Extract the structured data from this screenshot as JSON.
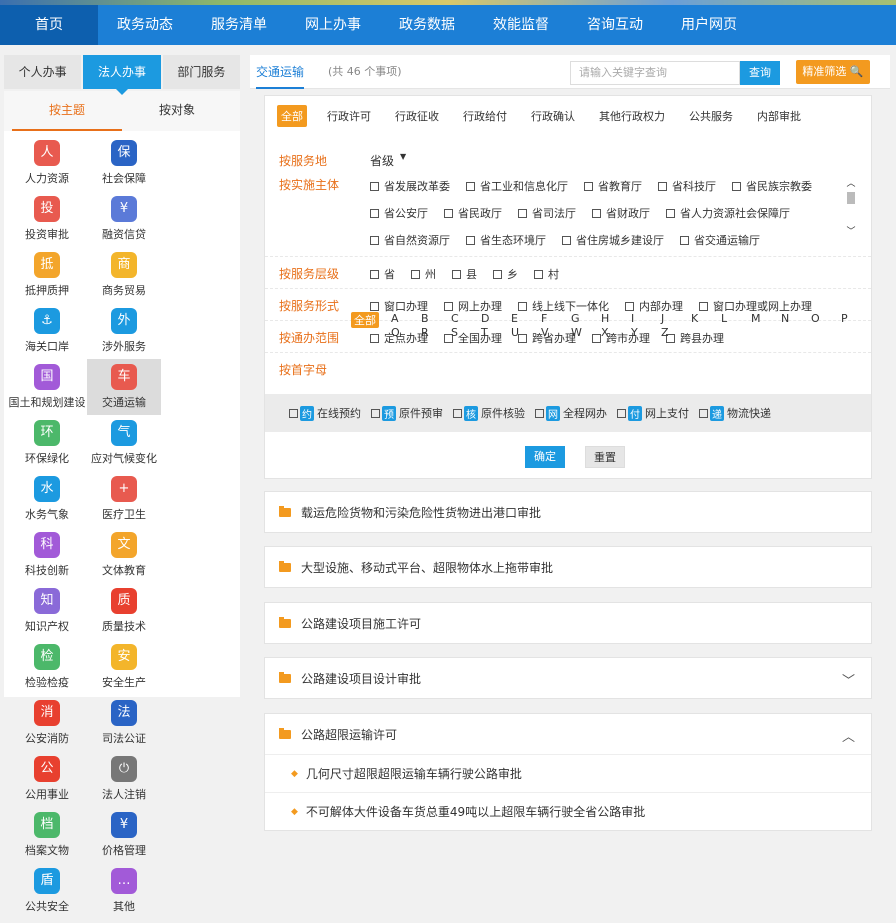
{
  "nav": [
    "首页",
    "政务动态",
    "服务清单",
    "网上办事",
    "政务数据",
    "效能监督",
    "咨询互动",
    "用户网页"
  ],
  "left": {
    "tabs": [
      "个人办事",
      "法人办事",
      "部门服务"
    ],
    "subtabs": [
      "按主题",
      "按对象"
    ],
    "categories": [
      {
        "label": "人力资源",
        "color": "#e85a4f",
        "glyph": "人"
      },
      {
        "label": "社会保障",
        "color": "#2a64c5",
        "glyph": "保"
      },
      {
        "label": "投资审批",
        "color": "#e85a4f",
        "glyph": "投"
      },
      {
        "label": "融资信贷",
        "color": "#5b7ad8",
        "glyph": "¥"
      },
      {
        "label": "抵押质押",
        "color": "#f3a52b",
        "glyph": "抵"
      },
      {
        "label": "商务贸易",
        "color": "#f3b52b",
        "glyph": "商"
      },
      {
        "label": "海关口岸",
        "color": "#1c9ae0",
        "glyph": "⚓"
      },
      {
        "label": "涉外服务",
        "color": "#1c9ae0",
        "glyph": "外"
      },
      {
        "label": "国土和规划建设",
        "color": "#a25ad8",
        "glyph": "国"
      },
      {
        "label": "交通运输",
        "color": "#e85a4f",
        "glyph": "车"
      },
      {
        "label": "环保绿化",
        "color": "#4cb86a",
        "glyph": "环"
      },
      {
        "label": "应对气候变化",
        "color": "#1c9ae0",
        "glyph": "气"
      },
      {
        "label": "水务气象",
        "color": "#1c9ae0",
        "glyph": "水"
      },
      {
        "label": "医疗卫生",
        "color": "#e85a4f",
        "glyph": "+"
      },
      {
        "label": "科技创新",
        "color": "#a25ad8",
        "glyph": "科"
      },
      {
        "label": "文体教育",
        "color": "#f3a52b",
        "glyph": "文"
      },
      {
        "label": "知识产权",
        "color": "#8a6ad8",
        "glyph": "知"
      },
      {
        "label": "质量技术",
        "color": "#e8402f",
        "glyph": "质"
      },
      {
        "label": "检验检疫",
        "color": "#4cb86a",
        "glyph": "检"
      },
      {
        "label": "安全生产",
        "color": "#f3b52b",
        "glyph": "安"
      },
      {
        "label": "公安消防",
        "color": "#e8402f",
        "glyph": "消"
      },
      {
        "label": "司法公证",
        "color": "#2a64c5",
        "glyph": "法"
      },
      {
        "label": "公用事业",
        "color": "#e8402f",
        "glyph": "公"
      },
      {
        "label": "法人注销",
        "color": "#777777",
        "glyph": "⏻"
      },
      {
        "label": "档案文物",
        "color": "#4cb86a",
        "glyph": "档"
      },
      {
        "label": "价格管理",
        "color": "#2a64c5",
        "glyph": "¥"
      },
      {
        "label": "公共安全",
        "color": "#1c9ae0",
        "glyph": "盾"
      },
      {
        "label": "其他",
        "color": "#a25ad8",
        "glyph": "…"
      }
    ]
  },
  "right": {
    "title": "交通运输",
    "count": "(共 46 个事项)",
    "search_placeholder": "请输入关键字查询",
    "search_btn": "查询",
    "advanced_btn": "精准筛选",
    "types": [
      "全部",
      "行政许可",
      "行政征收",
      "行政给付",
      "行政确认",
      "其他行政权力",
      "公共服务",
      "内部审批"
    ],
    "filters": {
      "place_label": "按服务地",
      "place_value": "省级",
      "body_label": "按实施主体",
      "bodies": [
        "省发展改革委",
        "省工业和信息化厅",
        "省教育厅",
        "省科技厅",
        "省民族宗教委",
        "省公安厅",
        "省民政厅",
        "省司法厅",
        "省财政厅",
        "省人力资源社会保障厅",
        "省自然资源厅",
        "省生态环境厅",
        "省住房城乡建设厅",
        "省交通运输厅"
      ],
      "level_label": "按服务层级",
      "levels": [
        "省",
        "州",
        "县",
        "乡",
        "村"
      ],
      "form_label": "按服务形式",
      "forms": [
        "窗口办理",
        "网上办理",
        "线上线下一体化",
        "内部办理",
        "窗口办理或网上办理"
      ],
      "range_label": "按通办范围",
      "ranges": [
        "定点办理",
        "全国办理",
        "跨省办理",
        "跨市办理",
        "跨县办理"
      ],
      "letter_label": "按首字母",
      "letters_all": "全部",
      "letters": [
        "A",
        "B",
        "C",
        "D",
        "E",
        "F",
        "G",
        "H",
        "I",
        "J",
        "K",
        "L",
        "M",
        "N",
        "O",
        "P",
        "Q",
        "R",
        "S",
        "T",
        "U",
        "V",
        "W",
        "X",
        "Y",
        "Z"
      ]
    },
    "features": [
      {
        "tag": "约",
        "label": "在线预约"
      },
      {
        "tag": "预",
        "label": "原件预审"
      },
      {
        "tag": "核",
        "label": "原件核验"
      },
      {
        "tag": "网",
        "label": "全程网办"
      },
      {
        "tag": "付",
        "label": "网上支付"
      },
      {
        "tag": "递",
        "label": "物流快递"
      }
    ],
    "confirm": "确定",
    "reset": "重置",
    "items": [
      "载运危险货物和污染危险性货物进出港口审批",
      "大型设施、移动式平台、超限物体水上拖带审批",
      "公路建设项目施工许可",
      "公路建设项目设计审批",
      "公路超限运输许可"
    ],
    "subitems": [
      "几何尺寸超限超限运输车辆行驶公路审批",
      "不可解体大件设备车货总重49吨以上超限车辆行驶全省公路审批"
    ]
  }
}
